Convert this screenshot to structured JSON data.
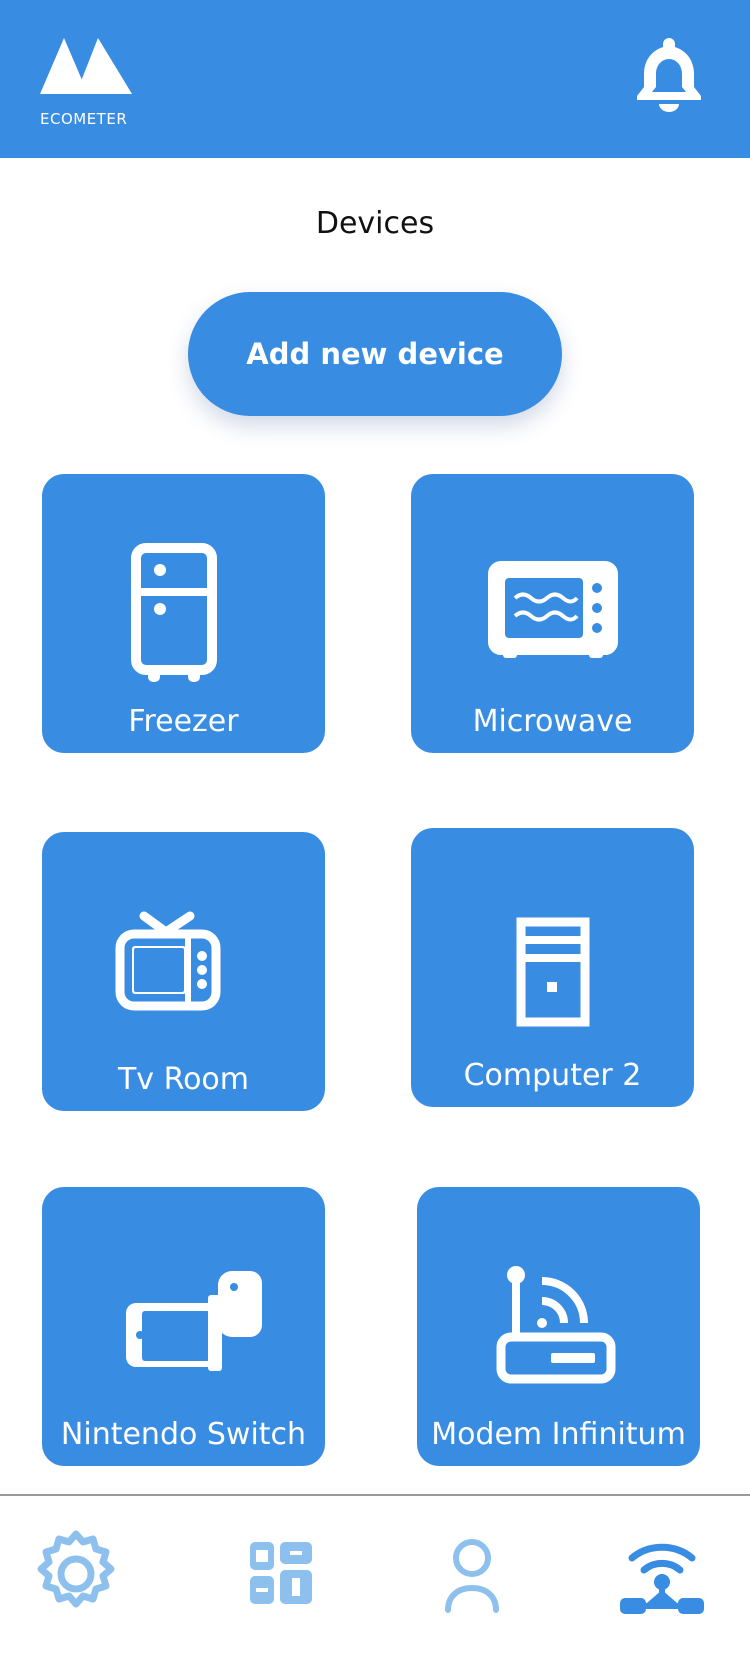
{
  "header": {
    "logo_icon": "ecometer-logo-icon",
    "brand": "ECOMETER",
    "notification_icon": "bell-icon"
  },
  "main": {
    "title": "Devices",
    "add_button_label": "Add new device",
    "devices": [
      {
        "label": "Freezer",
        "icon": "fridge-icon"
      },
      {
        "label": "Microwave",
        "icon": "microwave-icon"
      },
      {
        "label": "Tv Room",
        "icon": "tv-icon"
      },
      {
        "label": "Computer 2",
        "icon": "computer-tower-icon"
      },
      {
        "label": "Nintendo Switch",
        "icon": "game-console-icon"
      },
      {
        "label": "Modem Infinitum",
        "icon": "router-icon"
      }
    ]
  },
  "bottom_nav": {
    "items": [
      {
        "icon": "settings-gear-icon"
      },
      {
        "icon": "dashboard-grid-icon"
      },
      {
        "icon": "user-profile-icon"
      },
      {
        "icon": "network-signal-icon",
        "active": true
      }
    ]
  },
  "colors": {
    "primary": "#388ce2",
    "nav_inactive": "#8ec0ee",
    "nav_active": "#388ce2",
    "background": "#ffffff"
  }
}
